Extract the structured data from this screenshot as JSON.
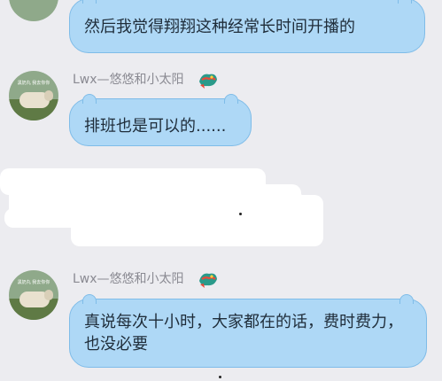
{
  "messages": [
    {
      "text": "然后我觉得翔翔这种经常长时间开播的"
    },
    {
      "username": "Lwx—悠悠和小太阳",
      "avatar_caption": "黑奶丸 我去你你",
      "badge_icon": "dragon-badge-icon",
      "text": "排班也是可以的......"
    },
    {
      "username": "Lwx—悠悠和小太阳",
      "avatar_caption": "黑奶丸 我去你你",
      "badge_icon": "dragon-badge-icon",
      "text": "真说每次十小时，大家都在的话，费时费力，也没必要"
    }
  ],
  "colors": {
    "background": "#ececf0",
    "bubble_fill": "#aed8f6",
    "bubble_border": "#7fbce8",
    "username": "#8a8a92"
  }
}
